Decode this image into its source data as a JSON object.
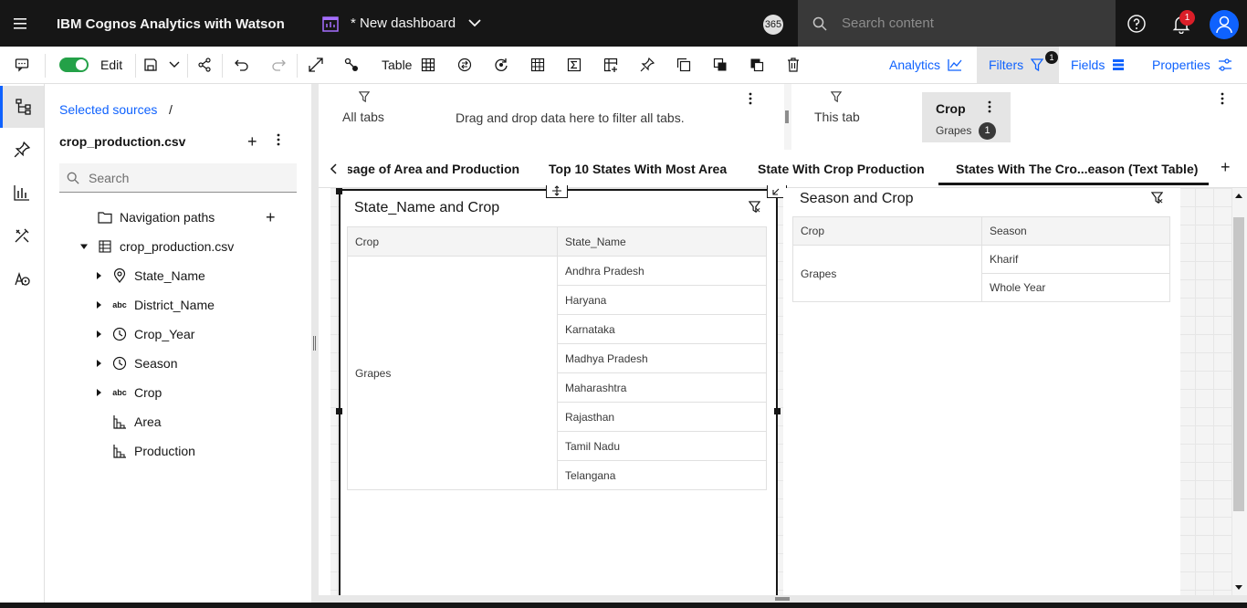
{
  "app": {
    "title": "IBM Cognos Analytics with Watson",
    "dashboard_name": "* New dashboard",
    "user_badge": "365",
    "search_placeholder": "Search content",
    "notifications_count": "1"
  },
  "toolbar": {
    "edit_label": "Edit",
    "table_label": "Table",
    "analytics_label": "Analytics",
    "filters_label": "Filters",
    "filters_count": "1",
    "fields_label": "Fields",
    "properties_label": "Properties",
    "accent_color": "#0f62fe",
    "toggle_color": "#24a148"
  },
  "sources": {
    "breadcrumb": "Selected sources",
    "breadcrumb_sep": "/",
    "source_name": "crop_production.csv",
    "search_placeholder": "Search",
    "navigation_paths": "Navigation paths",
    "table_name": "crop_production.csv",
    "fields": [
      {
        "label": "State_Name",
        "icon": "location-icon"
      },
      {
        "label": "District_Name",
        "icon": "abc-icon"
      },
      {
        "label": "Crop_Year",
        "icon": "clock-icon"
      },
      {
        "label": "Season",
        "icon": "clock-icon"
      },
      {
        "label": "Crop",
        "icon": "abc-icon"
      },
      {
        "label": "Area",
        "icon": "measure-icon"
      },
      {
        "label": "Production",
        "icon": "measure-icon"
      }
    ]
  },
  "filters": {
    "all_tabs_label": "All tabs",
    "drag_hint": "Drag and drop data here to filter all tabs.",
    "this_tab_label": "This tab",
    "chip_name": "Crop",
    "chip_value": "Grapes",
    "chip_count": "1"
  },
  "tabs": [
    {
      "label": "sage of Area and Production"
    },
    {
      "label": "Top 10 States With Most Area"
    },
    {
      "label": "State With Crop Production"
    },
    {
      "label": "States With The Cro...eason (Text Table)"
    }
  ],
  "widget1": {
    "title": "State_Name and Crop",
    "columns": [
      "Crop",
      "State_Name"
    ],
    "crop": "Grapes",
    "states": [
      "Andhra Pradesh",
      "Haryana",
      "Karnataka",
      "Madhya Pradesh",
      "Maharashtra",
      "Rajasthan",
      "Tamil Nadu",
      "Telangana"
    ]
  },
  "widget2": {
    "title": "Season and Crop",
    "columns": [
      "Crop",
      "Season"
    ],
    "crop": "Grapes",
    "seasons": [
      "Kharif",
      "Whole Year"
    ]
  }
}
